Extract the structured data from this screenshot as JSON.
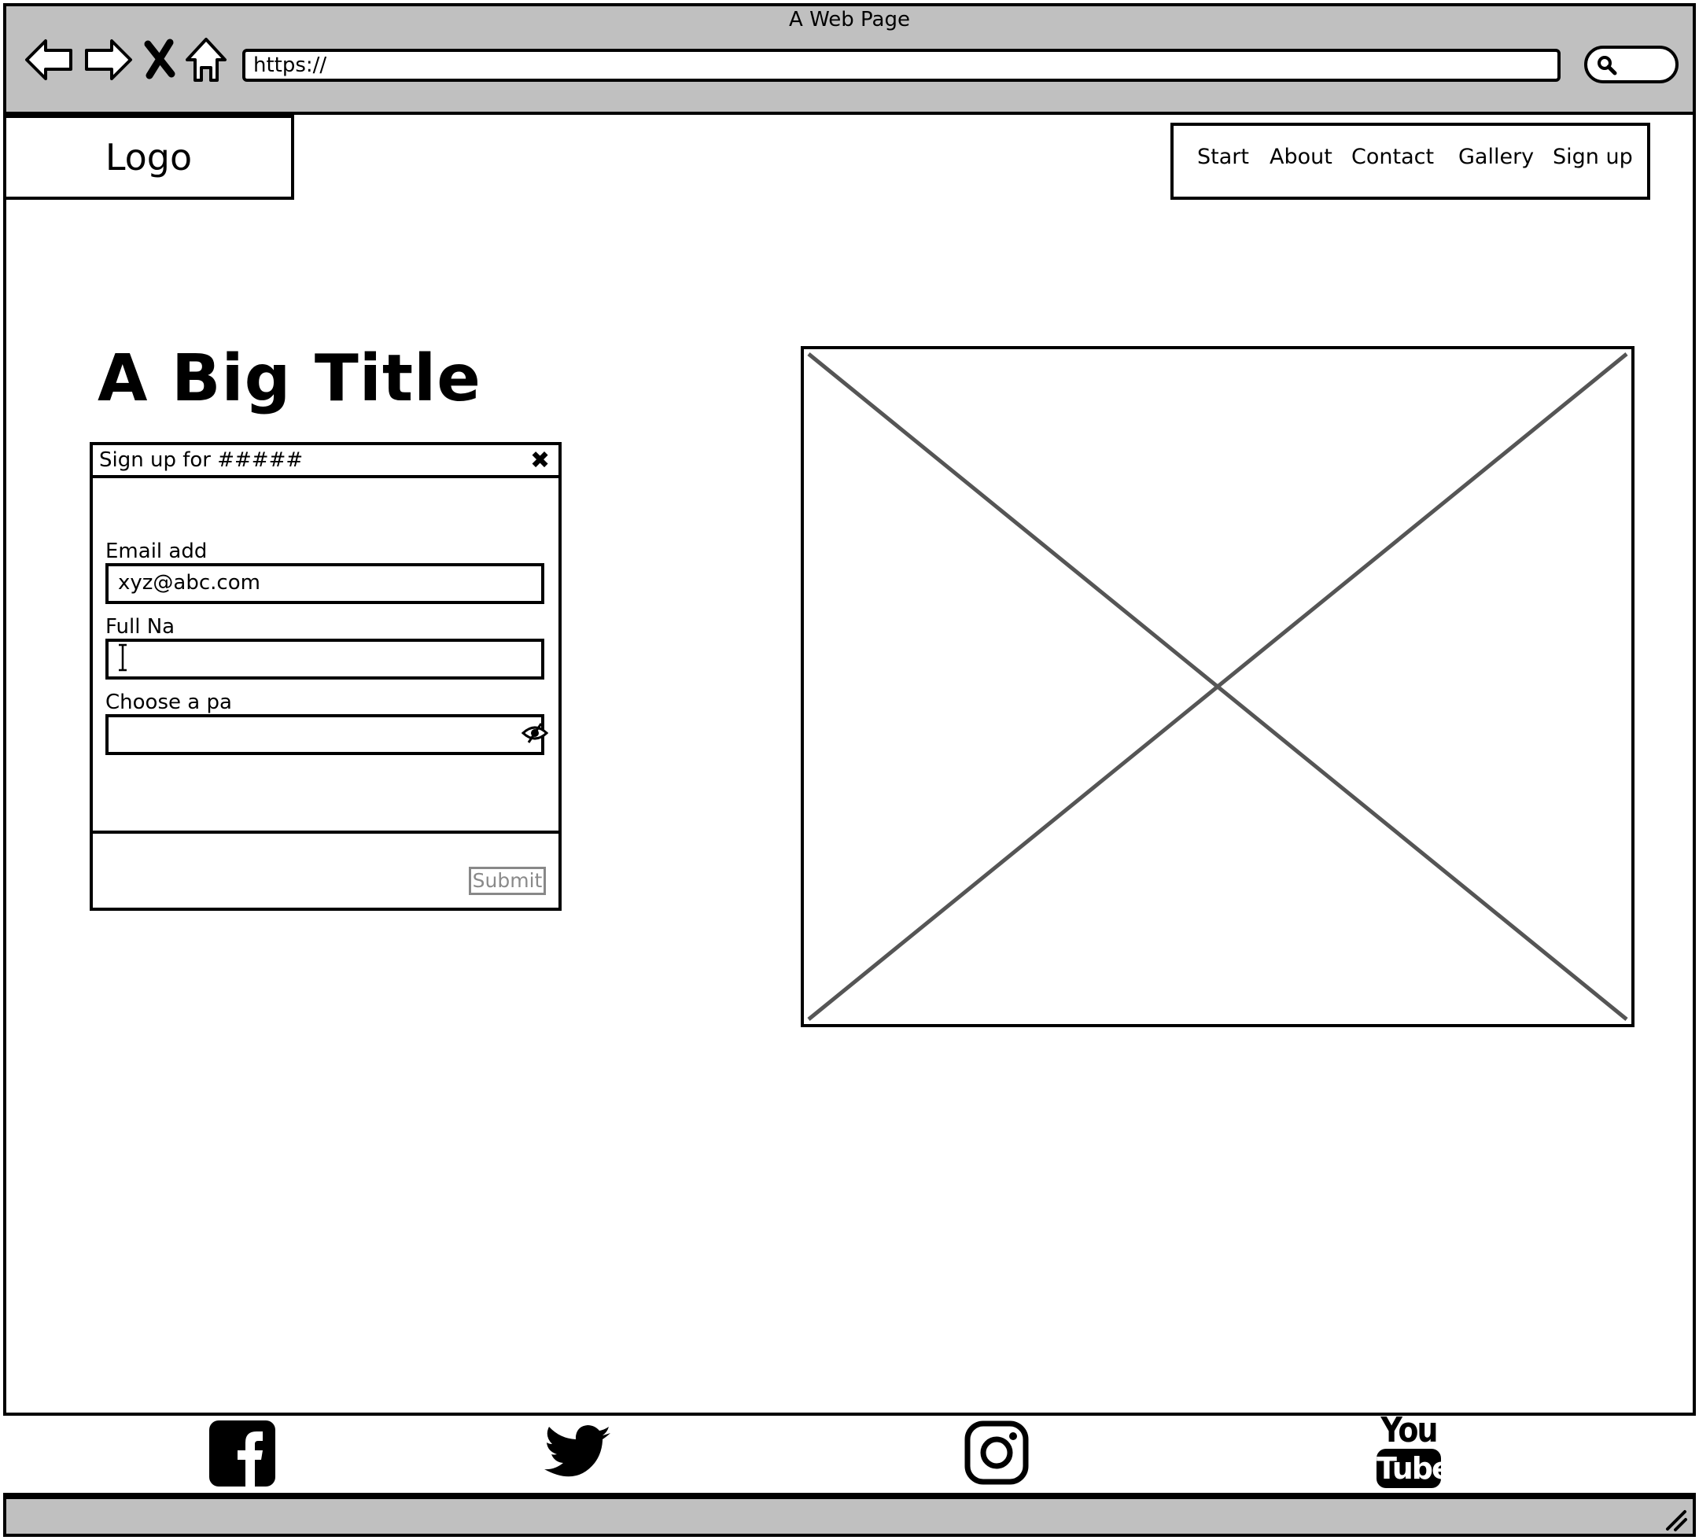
{
  "browser": {
    "window_title": "A Web Page",
    "url": "https://",
    "nav_icons": [
      "back-arrow-icon",
      "forward-arrow-icon",
      "stop-icon",
      "home-icon"
    ],
    "search_icon": "search-icon"
  },
  "header": {
    "logo": "Logo",
    "nav": [
      "Start",
      "About",
      "Contact",
      "Gallery",
      "Sign up"
    ]
  },
  "main": {
    "title": "A Big Title"
  },
  "dialog": {
    "title": "Sign up for #####",
    "email_label": "Email add",
    "email_value": "xyz@abc.com",
    "name_label": "Full Na",
    "name_value": "",
    "password_label": "Choose a pa",
    "password_value": "",
    "submit_label": "Submit"
  },
  "footer": {
    "social_icons": [
      "facebook-icon",
      "twitter-icon",
      "instagram-icon",
      "youtube-icon"
    ],
    "youtube_text_top": "You",
    "youtube_text_bottom": "Tube"
  },
  "colors": {
    "chrome_gray": "#c0c0c0",
    "placeholder_line": "#555555",
    "disabled_text": "#8a8a8a"
  }
}
